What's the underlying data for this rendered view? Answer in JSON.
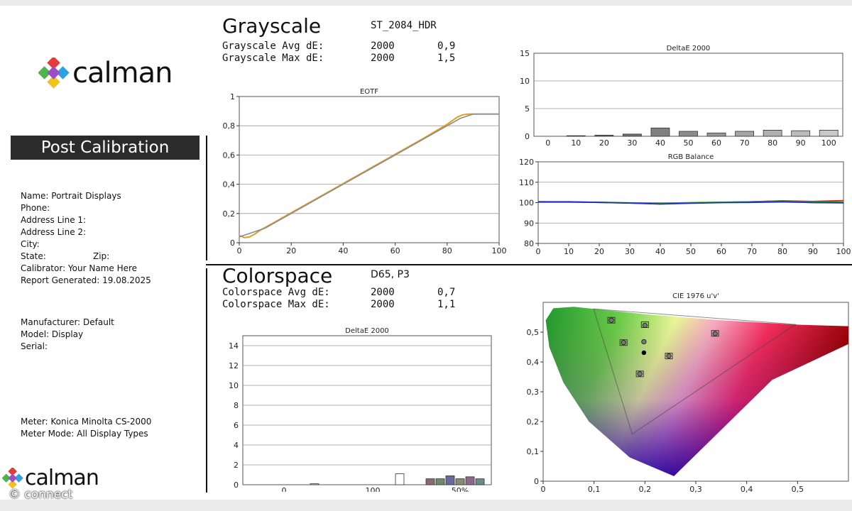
{
  "brand": {
    "logo_text": "calman",
    "footer_logo_text": "calman",
    "footer_sub_text": "© connect"
  },
  "banner": {
    "label": "Post Calibration"
  },
  "info": {
    "name": "Name: Portrait Displays",
    "phone": "Phone:",
    "address1": "Address Line 1:",
    "address2": "Address Line 2:",
    "city": "City:",
    "state": "State:",
    "zip": "Zip:",
    "calibrator": "Calibrator: Your Name Here",
    "report_generated": "Report Generated: 19.08.2025",
    "manufacturer": "Manufacturer: Default",
    "model": "Model: Display",
    "serial": "Serial:",
    "meter": "Meter: Konica Minolta CS-2000",
    "meter_mode": "Meter Mode: All Display Types"
  },
  "grayscale": {
    "title": "Grayscale",
    "mode": "ST_2084_HDR",
    "avg_label": "Grayscale Avg dE:",
    "avg_std": "2000",
    "avg_value": "0,9",
    "max_label": "Grayscale Max dE:",
    "max_std": "2000",
    "max_value": "1,5"
  },
  "colorspace": {
    "title": "Colorspace",
    "target": "D65, P3",
    "avg_label": "Colorspace Avg dE:",
    "avg_std": "2000",
    "avg_value": "0,7",
    "max_label": "Colorspace Max dE:",
    "max_std": "2000",
    "max_value": "1,1"
  },
  "colors": {
    "target_line": "#8c8c8c",
    "measured_line": "#e0a020",
    "red": "#d62020",
    "green": "#20a020",
    "blue": "#2030c0"
  },
  "chart_data": [
    {
      "type": "line",
      "title": "EOTF",
      "x_ticks": [
        "0",
        "20",
        "40",
        "60",
        "80",
        "100"
      ],
      "y_ticks": [
        "0",
        "0,2",
        "0,4",
        "0,6",
        "0,8",
        "1"
      ],
      "xlim": [
        0,
        100
      ],
      "ylim": [
        0,
        1
      ],
      "series": [
        {
          "x": [
            0,
            5,
            10,
            20,
            30,
            40,
            50,
            60,
            70,
            80,
            85,
            90,
            100
          ],
          "y": [
            0.04,
            0.07,
            0.1,
            0.2,
            0.3,
            0.4,
            0.5,
            0.6,
            0.7,
            0.8,
            0.85,
            0.88,
            0.88
          ]
        },
        {
          "x": [
            0,
            2,
            4,
            6,
            8,
            10,
            20,
            30,
            40,
            50,
            60,
            70,
            80,
            84,
            86,
            88,
            90,
            100
          ],
          "y": [
            0.05,
            0.035,
            0.04,
            0.06,
            0.085,
            0.105,
            0.205,
            0.305,
            0.405,
            0.505,
            0.605,
            0.705,
            0.81,
            0.86,
            0.875,
            0.88,
            0.88,
            0.88
          ]
        }
      ]
    },
    {
      "type": "bar",
      "title": "DeltaE 2000",
      "categories": [
        "0",
        "10",
        "20",
        "30",
        "40",
        "50",
        "60",
        "70",
        "80",
        "90",
        "100"
      ],
      "values": [
        0,
        0.1,
        0.2,
        0.4,
        1.5,
        0.9,
        0.6,
        0.9,
        1.1,
        1.0,
        1.1
      ],
      "y_ticks": [
        "0",
        "5",
        "10",
        "15"
      ],
      "ylim": [
        0,
        15
      ]
    },
    {
      "type": "line",
      "title": "RGB Balance",
      "x_ticks": [
        "0",
        "10",
        "20",
        "30",
        "40",
        "50",
        "60",
        "70",
        "80",
        "90",
        "100"
      ],
      "y_ticks": [
        "80",
        "90",
        "100",
        "110",
        "120"
      ],
      "xlim": [
        0,
        100
      ],
      "ylim": [
        80,
        120
      ],
      "series": [
        {
          "x": [
            0,
            10,
            20,
            30,
            40,
            50,
            60,
            70,
            80,
            90,
            100
          ],
          "y": [
            100.3,
            100.3,
            100.1,
            99.8,
            99.4,
            99.8,
            100.1,
            100.4,
            100.9,
            100.6,
            101.0
          ]
        },
        {
          "x": [
            0,
            10,
            20,
            30,
            40,
            50,
            60,
            70,
            80,
            90,
            100
          ],
          "y": [
            100.4,
            100.3,
            100.2,
            99.9,
            99.7,
            100.0,
            100.2,
            100.4,
            100.8,
            100.4,
            100.2
          ]
        },
        {
          "x": [
            0,
            10,
            20,
            30,
            40,
            50,
            60,
            70,
            80,
            90,
            100
          ],
          "y": [
            100.4,
            100.4,
            100.1,
            99.8,
            99.3,
            99.7,
            100.0,
            100.1,
            100.5,
            100.0,
            99.9
          ]
        }
      ]
    },
    {
      "type": "bar",
      "title": "DeltaE 2000",
      "categories": [
        "0",
        "100",
        "50%"
      ],
      "values": [
        0.1,
        1.1,
        0.6,
        0.6,
        0.9,
        0.6,
        0.8,
        0.6
      ],
      "y_ticks": [
        "0",
        "2",
        "4",
        "6",
        "8",
        "10",
        "12",
        "14"
      ],
      "ylim": [
        0,
        15
      ]
    },
    {
      "type": "scatter",
      "title": "CIE 1976 u'v'",
      "x_ticks": [
        "0",
        "0,1",
        "0,2",
        "0,3",
        "0,4",
        "0,5"
      ],
      "y_ticks": [
        "0",
        "0,1",
        "0,2",
        "0,3",
        "0,4",
        "0,5"
      ],
      "xlim": [
        0,
        0.6
      ],
      "ylim": [
        0,
        0.6
      ],
      "gamut_triangle": [
        [
          0.496,
          0.526
        ],
        [
          0.099,
          0.578
        ],
        [
          0.175,
          0.158
        ]
      ],
      "targets": [
        [
          0.134,
          0.54
        ],
        [
          0.2,
          0.525
        ],
        [
          0.338,
          0.496
        ],
        [
          0.247,
          0.42
        ],
        [
          0.19,
          0.36
        ],
        [
          0.158,
          0.465
        ]
      ],
      "measured": [
        [
          0.134,
          0.54
        ],
        [
          0.2,
          0.523
        ],
        [
          0.338,
          0.495
        ],
        [
          0.247,
          0.42
        ],
        [
          0.19,
          0.36
        ],
        [
          0.158,
          0.465
        ],
        [
          0.198,
          0.468
        ]
      ],
      "white_point": [
        0.198,
        0.431
      ]
    }
  ]
}
